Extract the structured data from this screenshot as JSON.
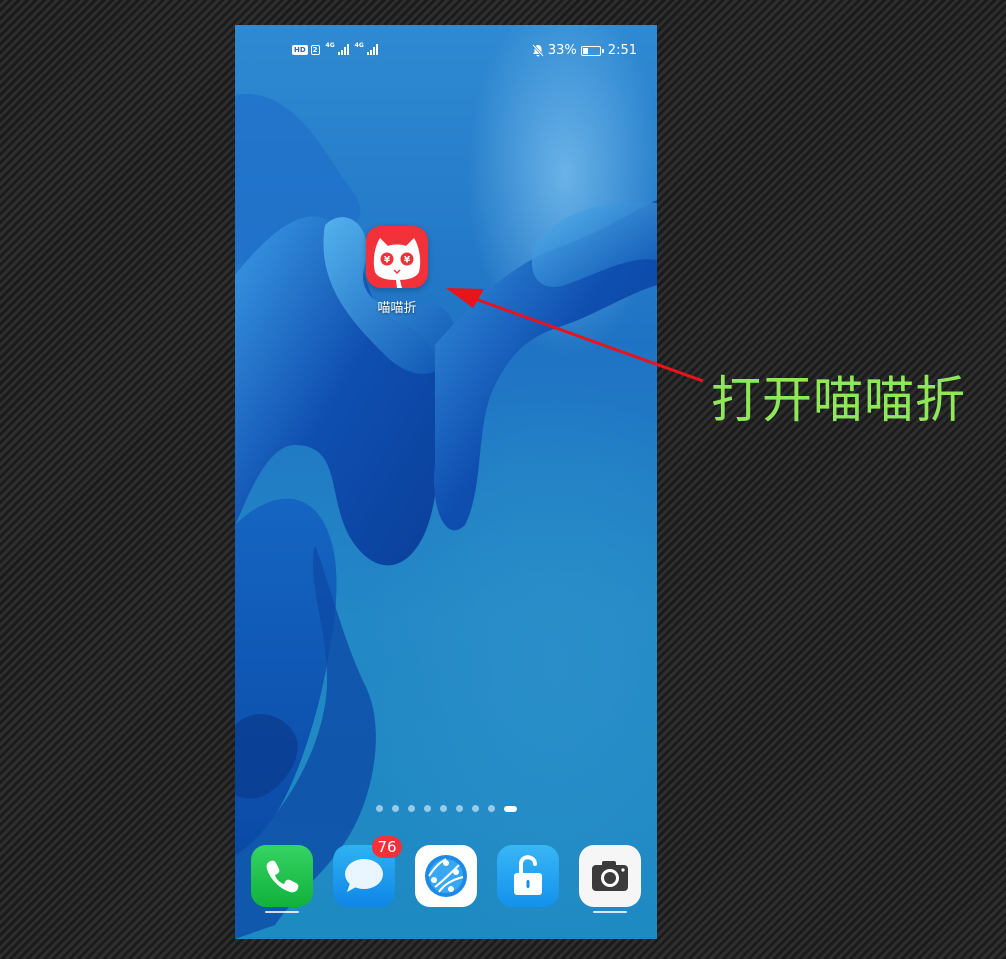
{
  "status_bar": {
    "hd": "HD",
    "sim": "2",
    "network_1": "4G",
    "network_2": "4G",
    "battery_percent": "33%",
    "battery_level": 0.33,
    "time": "2:51"
  },
  "home": {
    "app": {
      "label": "喵喵折",
      "icon": "cat-coin-icon"
    },
    "pages": {
      "count": 9,
      "active_index": 8
    },
    "dock": [
      {
        "name": "phone",
        "icon": "phone-icon"
      },
      {
        "name": "messages",
        "icon": "message-icon",
        "badge": "76"
      },
      {
        "name": "browser",
        "icon": "browser-icon"
      },
      {
        "name": "unlock",
        "icon": "lock-open-icon"
      },
      {
        "name": "camera",
        "icon": "camera-icon"
      }
    ]
  },
  "annotation": {
    "text": "打开喵喵折",
    "color": "#8ee85a",
    "arrow_color": "#e8131c"
  }
}
